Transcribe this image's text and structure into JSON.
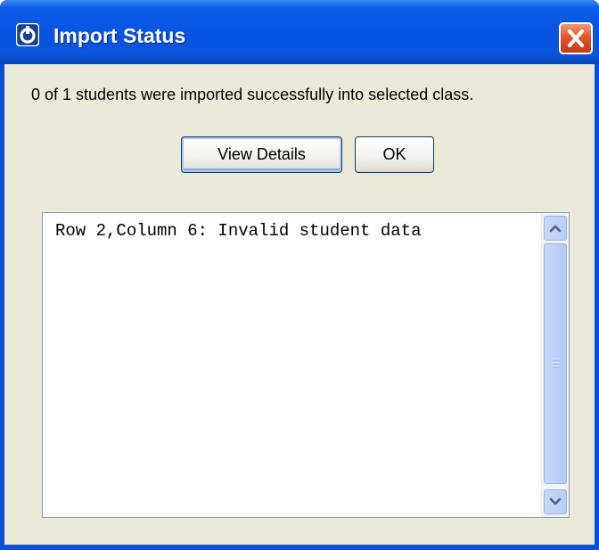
{
  "window": {
    "title": "Import Status",
    "colors": {
      "titlebar": "#0554e3",
      "client_background": "#ece9d8",
      "close_button": "#e4552a"
    }
  },
  "icons": {
    "app": "app-logo-icon",
    "close": "close-icon",
    "scroll_up": "chevron-up-icon",
    "scroll_down": "chevron-down-icon",
    "grip": "grip-icon"
  },
  "message": "0 of 1 students were imported successfully into selected class.",
  "buttons": {
    "view_details": "View Details",
    "ok": "OK"
  },
  "log": {
    "lines": [
      "Row 2,Column 6: Invalid student data"
    ]
  }
}
